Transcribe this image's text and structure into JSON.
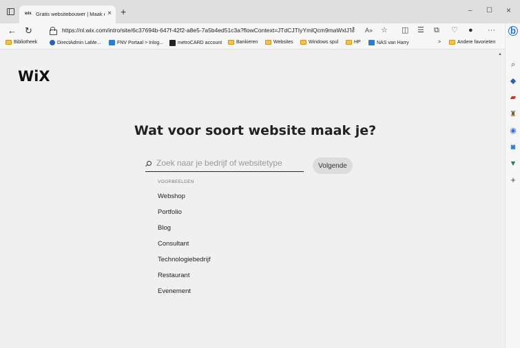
{
  "browser": {
    "tab": {
      "favicon": "wix",
      "title": "Gratis websitebouwer | Maak een",
      "close": "×"
    },
    "new_tab": "+",
    "window": {
      "minimize": "–",
      "restore": "☐",
      "close": "×"
    },
    "nav": {
      "back": "←",
      "refresh": "↻"
    },
    "url": "https://nl.wix.com/intro/site/6c37694b-647f-42f2-a8e5-7a5b4ed51c3a?flowContext=JTdCJTIyYmlQcm9maWxlJTI...",
    "toolbar_icons": [
      "key-icon",
      "read-aloud-icon",
      "favorite-star-icon",
      "split-screen-icon",
      "favorites-list-icon",
      "collections-icon",
      "performance-icon",
      "profile-avatar-icon",
      "more-icon"
    ],
    "more": "···",
    "bookmarks": [
      {
        "label": "Bibliotheek",
        "icon": "folder"
      },
      {
        "label": "DirectAdmin LaMe...",
        "icon": "dot"
      },
      {
        "label": "FNV Portaal > Inlog...",
        "icon": "square"
      },
      {
        "label": "metroCARD account",
        "icon": "dark"
      },
      {
        "label": "Bankieren",
        "icon": "folder"
      },
      {
        "label": "Websites",
        "icon": "folder"
      },
      {
        "label": "Windows spul",
        "icon": "folder"
      },
      {
        "label": "HP",
        "icon": "folder"
      },
      {
        "label": "NAS van Harry",
        "icon": "square"
      }
    ],
    "bookmarks_overflow": ">",
    "other_favorites": "Andere favorieten"
  },
  "sidebar": {
    "icons": [
      "bing-icon",
      "search-icon",
      "shopping-tag-icon",
      "tools-icon",
      "games-icon",
      "office-icon",
      "outlook-icon",
      "drop-icon",
      "add-icon"
    ]
  },
  "page": {
    "logo": "WiX",
    "headline": "Wat voor soort website maak je?",
    "search_placeholder": "Zoek naar je bedrijf of websitetype",
    "next_button": "Volgende",
    "examples_label": "VOORBEELDEN",
    "examples": [
      "Webshop",
      "Portfolio",
      "Blog",
      "Consultant",
      "Technologiebedrijf",
      "Restaurant",
      "Evenement"
    ]
  },
  "colors": {
    "page_bg": "#f0f0f0",
    "button_bg": "#dcdcdc",
    "text": "#222222",
    "bing_blue": "#1e6fd9"
  }
}
